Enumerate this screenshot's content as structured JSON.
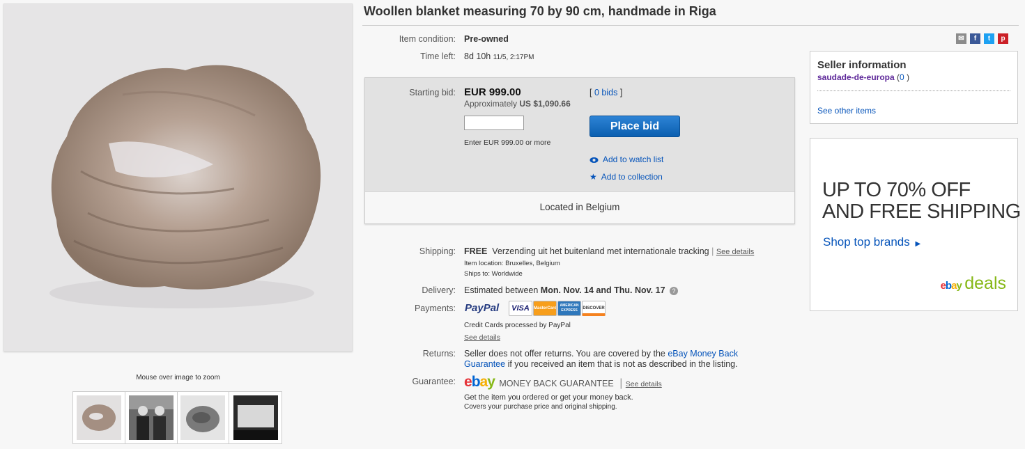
{
  "item": {
    "title": "Woollen blanket measuring 70 by 90 cm, handmade in Riga",
    "condition_label": "Item condition:",
    "condition_value": "Pre-owned",
    "time_left_label": "Time left:",
    "time_left_value": "8d 10h",
    "time_left_end": "11/5, 2:17PM"
  },
  "gallery": {
    "zoom_hint": "Mouse over image to zoom"
  },
  "bid": {
    "starting_bid_label": "Starting bid:",
    "price": "EUR 999.00",
    "approx_prefix": "Approximately",
    "approx_value": "US $1,090.66",
    "bids_open": "[",
    "bids_link": "0 bids",
    "bids_close": "]",
    "input_hint": "Enter EUR 999.00 or more",
    "place_bid": "Place bid",
    "watch": "Add to watch list",
    "collection": "Add to collection",
    "location": "Located in Belgium"
  },
  "shipping": {
    "label": "Shipping:",
    "free": "FREE",
    "method": "Verzending uit het buitenland met internationale tracking",
    "sep": "|",
    "see_details": "See details",
    "location_label": "Item location:",
    "location_value": "Bruxelles, Belgium",
    "ships_label": "Ships to:",
    "ships_value": "Worldwide"
  },
  "delivery": {
    "label": "Delivery:",
    "prefix": "Estimated between",
    "dates": "Mon. Nov. 14 and Thu. Nov. 17",
    "help": "?"
  },
  "payments": {
    "label": "Payments:",
    "paypal": "PayPal",
    "cards": [
      "VISA",
      "MasterCard",
      "AMERICAN EXPRESS",
      "DISCOVER"
    ],
    "note": "Credit Cards processed by PayPal",
    "see_details": "See details"
  },
  "returns": {
    "label": "Returns:",
    "text1": "Seller does not offer returns. You are covered by the",
    "link": "eBay Money Back Guarantee",
    "text2": "if you received an item that is not as described in the listing."
  },
  "guarantee": {
    "label": "Guarantee:",
    "ebay": "ebay",
    "mbg": "MONEY BACK GUARANTEE",
    "sep": "|",
    "see_details": "See details",
    "line1": "Get the item you ordered or get your money back.",
    "line2": "Covers your purchase price and original shipping."
  },
  "seller": {
    "heading": "Seller information",
    "name": "saudade-de-europa",
    "score_open": "(",
    "score": "0",
    "score_close": ")",
    "see_other": "See other items"
  },
  "ad": {
    "line1_a": "UP TO",
    "line1_b": "70% OFF",
    "line2": "AND FREE SHIPPING",
    "cta": "Shop top brands",
    "brand_ebay": "ebay",
    "brand_deals": "deals"
  },
  "colors": {
    "link": "#0654ba",
    "button": "#0b5fb0",
    "seller_name": "#5d2799",
    "deals_green": "#86b817"
  },
  "icons": {
    "share": [
      "email-icon",
      "facebook-icon",
      "twitter-icon",
      "pinterest-icon"
    ]
  }
}
